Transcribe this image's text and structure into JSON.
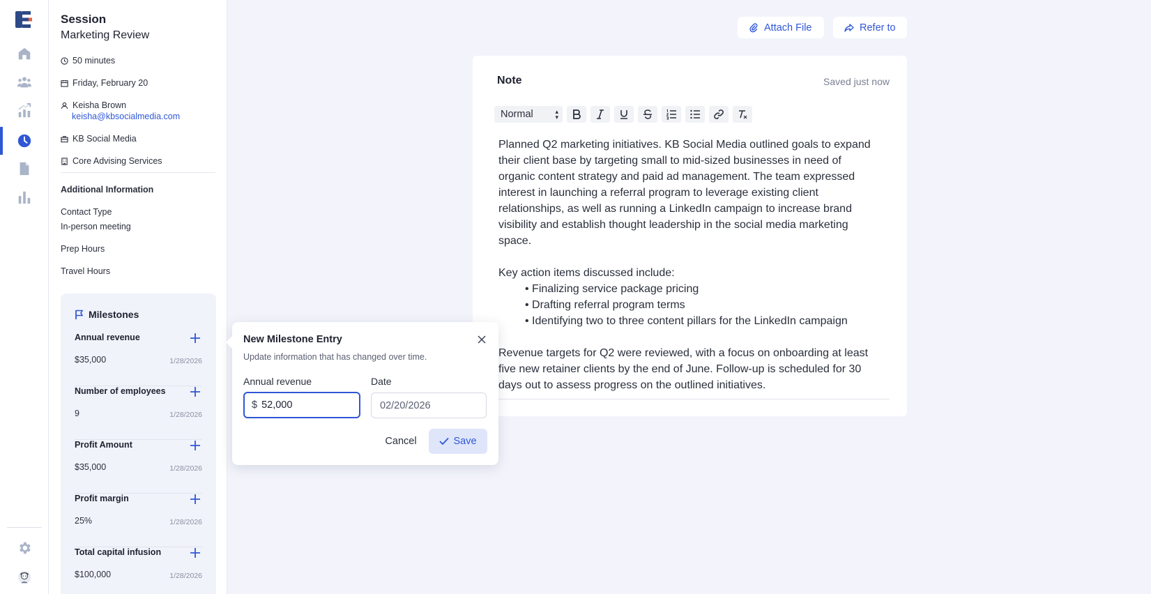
{
  "rail": {
    "items": [
      {
        "icon": "home-icon"
      },
      {
        "icon": "people-icon"
      },
      {
        "icon": "growth-chart-icon"
      },
      {
        "icon": "clock-icon",
        "active": true
      },
      {
        "icon": "document-icon"
      },
      {
        "icon": "bar-chart-icon"
      }
    ],
    "bottom": [
      {
        "icon": "gear-icon"
      },
      {
        "icon": "avatar"
      }
    ]
  },
  "session": {
    "label": "Session",
    "title": "Marketing Review",
    "duration": "50 minutes",
    "date": "Friday, February 20",
    "contact_name": "Keisha Brown",
    "contact_email": "keisha@kbsocialmedia.com",
    "company": "KB Social Media",
    "service": "Core Advising Services"
  },
  "additional": {
    "title": "Additional Information",
    "contact_type_label": "Contact Type",
    "contact_type_value": "In-person meeting",
    "prep_hours_label": "Prep Hours",
    "travel_hours_label": "Travel Hours"
  },
  "milestones": {
    "title": "Milestones",
    "items": [
      {
        "name": "Annual revenue",
        "value": "$35,000",
        "date": "1/28/2026"
      },
      {
        "name": "Number of employees",
        "value": "9",
        "date": "1/28/2026"
      },
      {
        "name": "Profit Amount",
        "value": "$35,000",
        "date": "1/28/2026"
      },
      {
        "name": "Profit margin",
        "value": "25%",
        "date": "1/28/2026"
      },
      {
        "name": "Total capital infusion",
        "value": "$100,000",
        "date": "1/28/2026"
      }
    ]
  },
  "actions": {
    "attach_label": "Attach File",
    "refer_label": "Refer to"
  },
  "note": {
    "title": "Note",
    "status": "Saved just now",
    "format_select": "Normal",
    "paragraph1": "Planned Q2 marketing initiatives. KB Social Media outlined goals to expand their client base by targeting small to mid-sized businesses in need of organic content strategy and paid ad management. The team expressed interest in launching a referral program to leverage existing client relationships, as well as running a LinkedIn campaign to increase brand visibility and establish thought leadership in the social media marketing space.",
    "list_intro": "Key action items discussed include:",
    "bullets": [
      "Finalizing service package pricing",
      "Drafting referral program terms",
      "Identifying two to three content pillars for the LinkedIn campaign"
    ],
    "paragraph2": "Revenue targets for Q2 were reviewed, with a focus on onboarding at least five new retainer clients by the end of June. Follow-up is scheduled for 30 days out to assess progress on the outlined initiatives."
  },
  "popover": {
    "title": "New Milestone Entry",
    "subtitle": "Update information that has changed over time.",
    "amount_label": "Annual revenue",
    "currency": "$",
    "amount_value": "52,000",
    "date_label": "Date",
    "date_value": "02/20/2026",
    "cancel_label": "Cancel",
    "save_label": "Save"
  },
  "colors": {
    "accent": "#2f57d6",
    "background": "#f3f4fb",
    "milestone_panel": "#f1f3fa",
    "save_button": "#dfe6fa"
  }
}
